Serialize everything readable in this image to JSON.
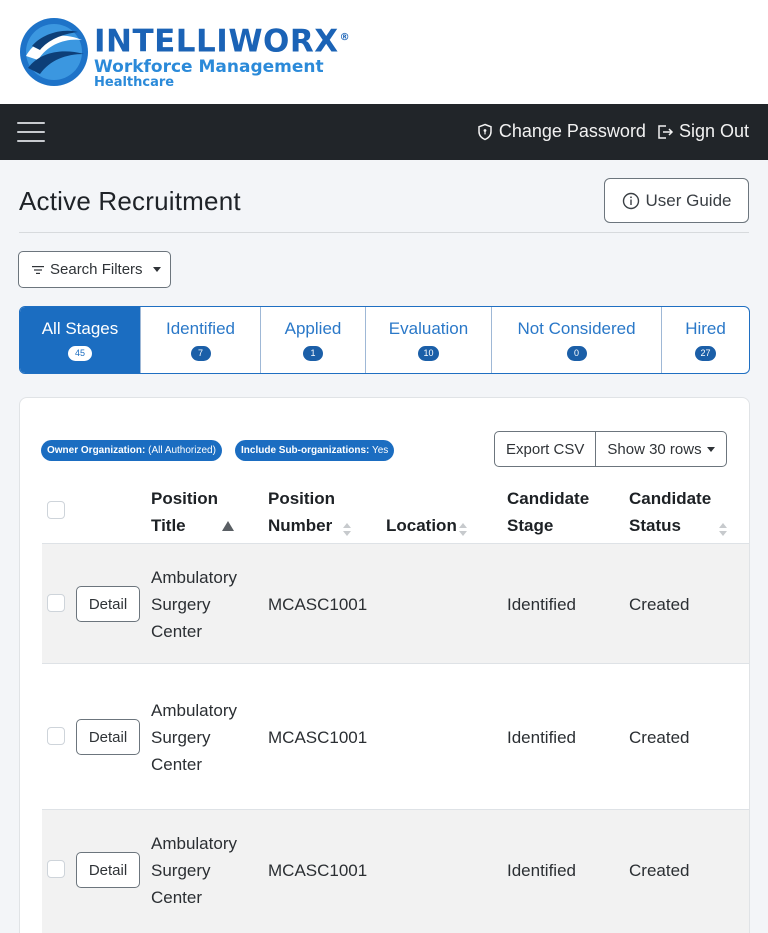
{
  "logo": {
    "brand": "INTELLIWORX",
    "registered": "®",
    "subtitle": "Workforce Management",
    "subtitle2": "Healthcare"
  },
  "navbar": {
    "menu_icon": "hamburger-icon",
    "change_password": "Change Password",
    "sign_out": "Sign Out"
  },
  "page": {
    "title": "Active Recruitment",
    "user_guide": "User Guide"
  },
  "filters": {
    "search_filters": "Search Filters"
  },
  "stages": [
    {
      "label": "All Stages",
      "count": "45"
    },
    {
      "label": "Identified",
      "count": "7"
    },
    {
      "label": "Applied",
      "count": "1"
    },
    {
      "label": "Evaluation",
      "count": "10"
    },
    {
      "label": "Not Considered",
      "count": "0"
    },
    {
      "label": "Hired",
      "count": "27"
    }
  ],
  "badges": {
    "owner_org_label": "Owner Organization:",
    "owner_org_value": " (All Authorized)",
    "sub_org_label": "Include Sub-organizations:",
    "sub_org_value": " Yes"
  },
  "toolbar": {
    "export_csv": "Export CSV",
    "show_rows": "Show 30 rows"
  },
  "table": {
    "columns": {
      "position_title": [
        "Position",
        "Title"
      ],
      "position_number": [
        "Position",
        "Number"
      ],
      "location": "Location",
      "candidate_stage": [
        "Candidate",
        "Stage"
      ],
      "candidate_status": [
        "Candidate",
        "Status"
      ]
    },
    "detail_label": "Detail",
    "rows": [
      {
        "title": [
          "Ambulatory",
          "Surgery",
          "Center"
        ],
        "number": "MCASC1001",
        "location": "",
        "stage": "Identified",
        "status": "Created"
      },
      {
        "title": [
          "Ambulatory",
          "Surgery",
          "Center"
        ],
        "number": "MCASC1001",
        "location": "",
        "stage": "Identified",
        "status": "Created"
      },
      {
        "title": [
          "Ambulatory",
          "Surgery",
          "Center"
        ],
        "number": "MCASC1001",
        "location": "",
        "stage": "Identified",
        "status": "Created"
      }
    ]
  },
  "colors": {
    "primary": "#1b6dc1",
    "navbar": "#212529",
    "brand": "#1b63b6"
  }
}
